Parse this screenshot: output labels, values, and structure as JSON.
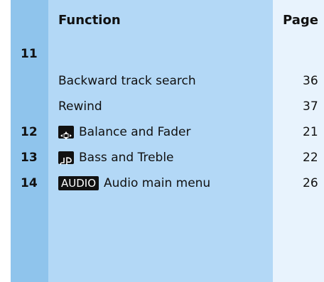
{
  "header": {
    "function": "Function",
    "page": "Page"
  },
  "rows": [
    {
      "number": "11",
      "function": "",
      "page": ""
    },
    {
      "number": "",
      "function": "Backward track search",
      "page": "36"
    },
    {
      "number": "",
      "function": "Rewind",
      "page": "37"
    },
    {
      "number": "12",
      "function": "Balance and Fader",
      "page": "21",
      "icon": "balance-fader-icon"
    },
    {
      "number": "13",
      "function": "Bass and Treble",
      "page": "22",
      "icon": "bass-treble-icon"
    },
    {
      "number": "14",
      "function": "Audio main menu",
      "page": "26",
      "icon_text": "AUDIO"
    }
  ],
  "colors": {
    "number_column": "#8fc4ec",
    "function_column": "#b3d8f6",
    "page_column": "#e8f3fd"
  }
}
